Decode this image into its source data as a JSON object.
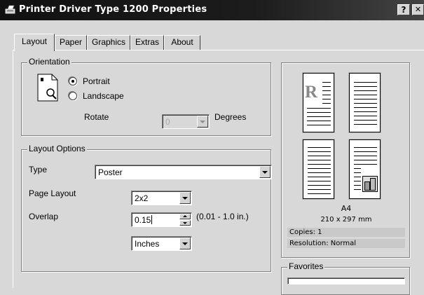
{
  "window": {
    "title": "Printer Driver Type 1200 Properties",
    "help_label": "?",
    "close_label": "✕"
  },
  "tabs": [
    {
      "label": "Layout",
      "active": true
    },
    {
      "label": "Paper",
      "active": false
    },
    {
      "label": "Graphics",
      "active": false
    },
    {
      "label": "Extras",
      "active": false
    },
    {
      "label": "About",
      "active": false
    }
  ],
  "orientation": {
    "group_label": "Orientation",
    "portrait_label": "Portrait",
    "landscape_label": "Landscape",
    "selected": "Portrait",
    "rotate_label": "Rotate",
    "rotate_value": "0",
    "degrees_label": "Degrees"
  },
  "layout_options": {
    "group_label": "Layout Options",
    "type_label": "Type",
    "type_value": "Poster",
    "page_layout_label": "Page Layout",
    "page_layout_value": "2x2",
    "overlap_label": "Overlap",
    "overlap_value": "0.15",
    "overlap_range": "(0.01 - 1.0 in.)",
    "units_value": "Inches"
  },
  "preview": {
    "paper_name": "A4",
    "paper_size": "210 x 297 mm",
    "copies": "Copies: 1",
    "resolution": "Resolution: Normal",
    "page_letter": "R"
  },
  "favorites": {
    "group_label": "Favorites"
  }
}
